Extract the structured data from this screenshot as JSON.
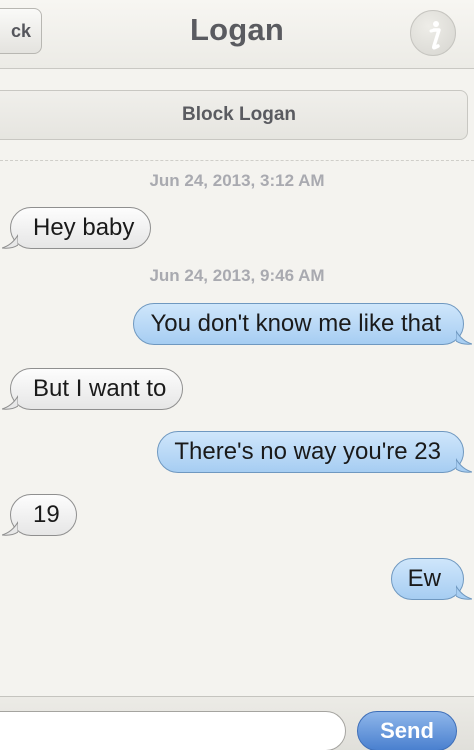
{
  "header": {
    "back_label": "ck",
    "title": "Logan",
    "info_icon": "info-icon"
  },
  "block_label": "Block Logan",
  "timestamps": [
    "Jun 24, 2013, 3:12 AM",
    "Jun 24, 2013, 9:46 AM"
  ],
  "messages": [
    {
      "direction": "incoming",
      "text": "Hey baby"
    },
    {
      "direction": "outgoing",
      "text": "You don't know me like that"
    },
    {
      "direction": "incoming",
      "text": "But I want to"
    },
    {
      "direction": "outgoing",
      "text": "There's no way you're 23"
    },
    {
      "direction": "incoming",
      "text": "19"
    },
    {
      "direction": "outgoing",
      "text": "Ew"
    }
  ],
  "compose": {
    "input_value": "",
    "send_label": "Send"
  },
  "colors": {
    "background": "#f4f3ef",
    "incoming_bubble": "#f0f0f0",
    "outgoing_bubble": "#b8d8f6",
    "send_button": "#4a80cf",
    "timestamp_text": "#a9aab0"
  }
}
